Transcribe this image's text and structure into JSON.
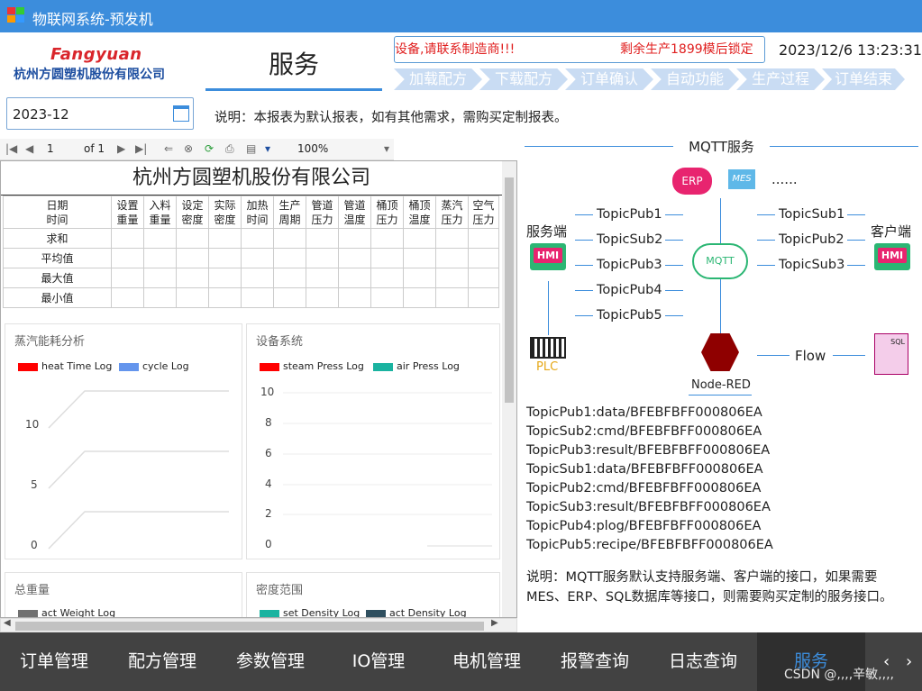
{
  "window": {
    "title": "物联网系统-预发机"
  },
  "header": {
    "logo_en": "Fangyuan",
    "logo_cn": "杭州方圆塑机股份有限公司",
    "page_title": "服务",
    "marquee_left": "设备,请联系制造商!!!",
    "marquee_right": "剩余生产1899模后锁定",
    "datetime": "2023/12/6 13:23:31",
    "steps": [
      "加载配方",
      "下载配方",
      "订单确认",
      "自动功能",
      "生产过程",
      "订单结束"
    ]
  },
  "filter": {
    "date_value": "2023-12",
    "description": "说明：本报表为默认报表，如有其他需求，需购买定制报表。"
  },
  "report_toolbar": {
    "page": "1",
    "of": "of 1",
    "zoom": "100%"
  },
  "report": {
    "title": "杭州方圆塑机股份有限公司",
    "headers": [
      [
        "日期",
        "时间"
      ],
      [
        "设置",
        "重量"
      ],
      [
        "入料",
        "重量"
      ],
      [
        "设定",
        "密度"
      ],
      [
        "实际",
        "密度"
      ],
      [
        "加热",
        "时间"
      ],
      [
        "生产",
        "周期"
      ],
      [
        "管道",
        "压力"
      ],
      [
        "管道",
        "温度"
      ],
      [
        "桶顶",
        "压力"
      ],
      [
        "桶顶",
        "温度"
      ],
      [
        "蒸汽",
        "压力"
      ],
      [
        "空气",
        "压力"
      ]
    ],
    "rows": [
      "求和",
      "平均值",
      "最大值",
      "最小值"
    ]
  },
  "chart_data": [
    {
      "type": "line",
      "title": "蒸汽能耗分析",
      "series": [
        {
          "name": "heat Time Log",
          "color": "#ff0000"
        },
        {
          "name": "cycle Log",
          "color": "#6495ed"
        }
      ],
      "y_ticks": [
        "10",
        "5",
        "0"
      ]
    },
    {
      "type": "line",
      "title": "设备系统",
      "series": [
        {
          "name": "steam Press Log",
          "color": "#ff0000"
        },
        {
          "name": "air Press Log",
          "color": "#1ab3a0"
        }
      ],
      "y_ticks": [
        "10",
        "8",
        "6",
        "4",
        "2",
        "0"
      ]
    },
    {
      "type": "line",
      "title": "总重量",
      "series": [
        {
          "name": "act Weight Log",
          "color": "#707070"
        }
      ]
    },
    {
      "type": "line",
      "title": "密度范围",
      "series": [
        {
          "name": "set Density Log",
          "color": "#1ab3a0"
        },
        {
          "name": "act Density Log",
          "color": "#2f4f5f"
        }
      ]
    }
  ],
  "mqtt": {
    "title": "MQTT服务",
    "server_label": "服务端",
    "client_label": "客户端",
    "hmi": "HMI",
    "erp": "ERP",
    "mes": "MES",
    "dots": "......",
    "mqtt_label": "MQTT",
    "plc": "PLC",
    "node_red": "Node-RED",
    "flow": "Flow",
    "sql": "SQL",
    "left_topics": [
      "TopicPub1",
      "TopicSub2",
      "TopicPub3",
      "TopicPub4",
      "TopicPub5"
    ],
    "right_topics": [
      "TopicSub1",
      "TopicPub2",
      "TopicSub3"
    ],
    "lines": [
      "TopicPub1:data/BFEBFBFF000806EA",
      "TopicSub2:cmd/BFEBFBFF000806EA",
      "TopicPub3:result/BFEBFBFF000806EA",
      "TopicSub1:data/BFEBFBFF000806EA",
      "TopicPub2:cmd/BFEBFBFF000806EA",
      "TopicSub3:result/BFEBFBFF000806EA",
      "TopicPub4:plog/BFEBFBFF000806EA",
      "TopicPub5:recipe/BFEBFBFF000806EA"
    ],
    "note": "说明：MQTT服务默认支持服务端、客户端的接口，如果需要MES、ERP、SQL数据库等接口，则需要购买定制的服务接口。"
  },
  "nav": [
    "订单管理",
    "配方管理",
    "参数管理",
    "IO管理",
    "电机管理",
    "报警查询",
    "日志查询",
    "服务"
  ],
  "watermark": "CSDN @,,,,辛敏,,,,"
}
